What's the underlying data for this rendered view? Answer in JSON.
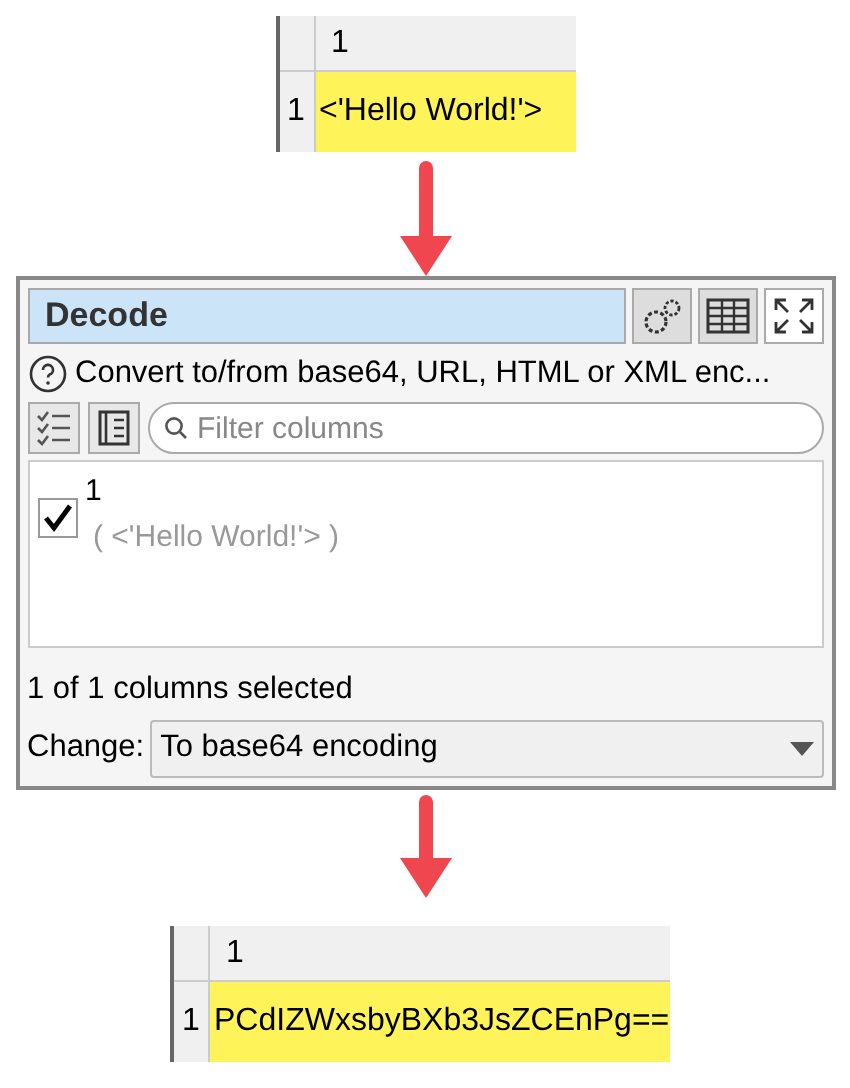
{
  "input_table": {
    "header": "1",
    "rows": [
      {
        "row_number": "1",
        "value": "<'Hello World!'>"
      }
    ]
  },
  "panel": {
    "title": "Decode",
    "description": "Convert to/from base64, URL, HTML or XML enc...",
    "filter": {
      "placeholder": "Filter columns"
    },
    "columns": [
      {
        "name": "1",
        "sample": "( <'Hello World!'> )",
        "checked": true
      }
    ],
    "selection_status": "1 of 1 columns selected",
    "change_label": "Change:",
    "change_value": "To base64 encoding"
  },
  "output_table": {
    "header": "1",
    "rows": [
      {
        "row_number": "1",
        "value": "PCdIZWxsbyBXb3JsZCEnPg=="
      }
    ]
  }
}
